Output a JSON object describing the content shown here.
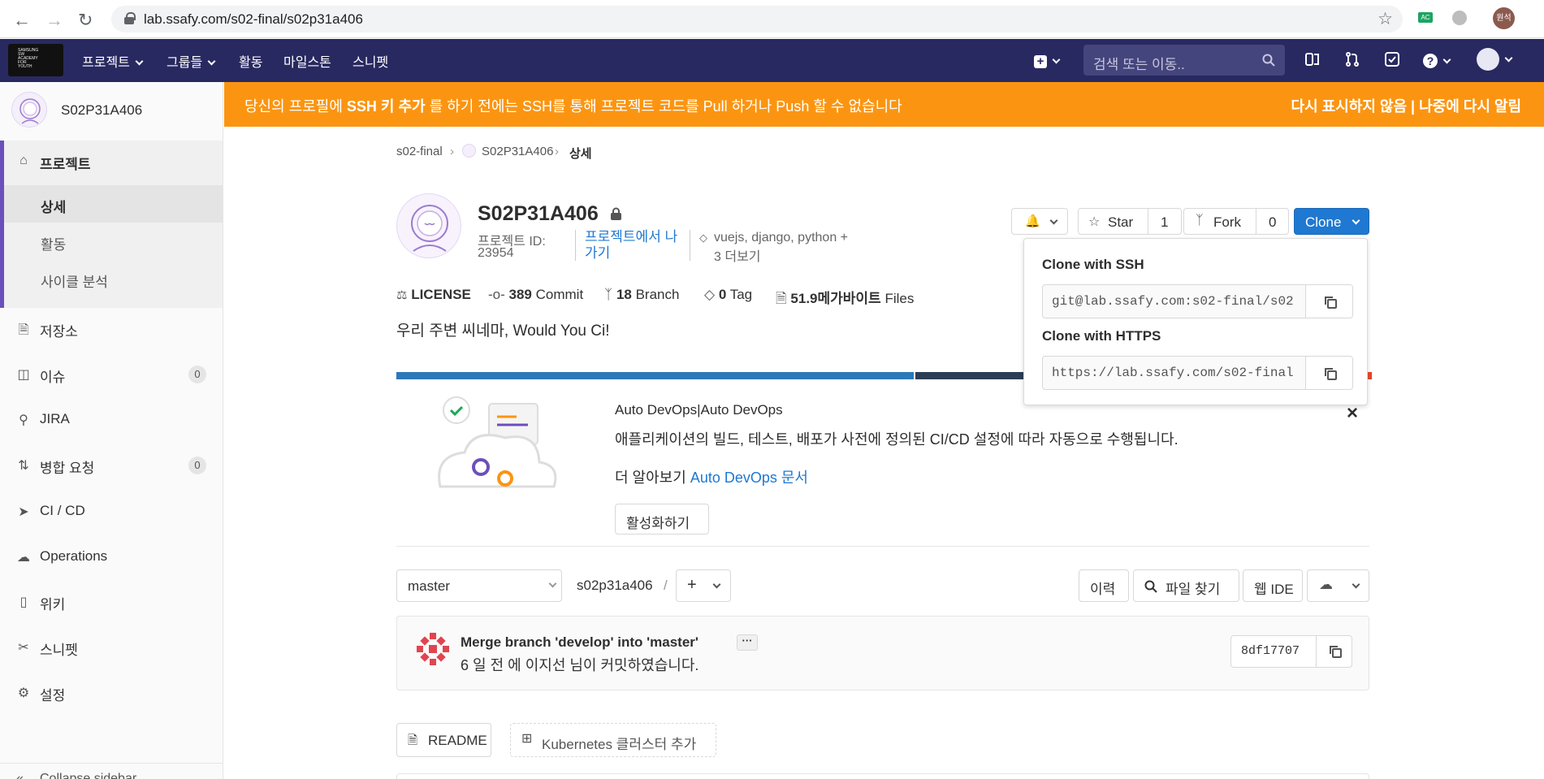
{
  "browser": {
    "url": "lab.ssafy.com/s02-final/s02p31a406",
    "profile_label": "원석",
    "ext_badge": "AC"
  },
  "topnav": {
    "items": [
      "프로젝트",
      "그룹들",
      "활동",
      "마일스톤",
      "스니펫"
    ],
    "search_placeholder": "검색 또는 이동.."
  },
  "sidebar": {
    "project_name": "S02P31A406",
    "section_title": "프로젝트",
    "sub_items": [
      "상세",
      "활동",
      "사이클 분석"
    ],
    "items": [
      {
        "label": "저장소"
      },
      {
        "label": "이슈",
        "badge": "0"
      },
      {
        "label": "JIRA"
      },
      {
        "label": "병합 요청",
        "badge": "0"
      },
      {
        "label": "CI / CD"
      },
      {
        "label": "Operations"
      },
      {
        "label": "위키"
      },
      {
        "label": "스니펫"
      },
      {
        "label": "설정"
      }
    ],
    "collapse_label": "Collapse sidebar"
  },
  "banner": {
    "pre": "당신의 프로필에 ",
    "bold": "SSH 키 추가",
    "post": " 를 하기 전에는 SSH를 통해 프로젝트 코드를 Pull 하거나 Push 할 수 없습니다",
    "dismiss": "다시 표시하지 않음",
    "sep": " | ",
    "later": "나중에 다시 알림"
  },
  "breadcrumb": [
    "s02-final",
    "S02P31A406",
    "상세"
  ],
  "project": {
    "title": "S02P31A406",
    "id_label": "프로젝트 ID:",
    "id_value": "23954",
    "leave_link": "프로젝트에서 나가기",
    "topics": "vuejs, django, python +",
    "more": "3 더보기",
    "star_label": "Star",
    "star_count": "1",
    "fork_label": "Fork",
    "fork_count": "0",
    "clone_label": "Clone",
    "description": "우리 주변 씨네마, Would You Ci!"
  },
  "stats": {
    "license": "LICENSE",
    "commit_count": "389",
    "commit_label": "Commit",
    "branch_count": "18",
    "branch_label": "Branch",
    "tag_count": "0",
    "tag_label": "Tag",
    "size": "51.9메가바이트",
    "size_label": "Files"
  },
  "clone_popup": {
    "ssh_title": "Clone with SSH",
    "ssh_url": "git@lab.ssafy.com:s02-final/s02",
    "https_title": "Clone with HTTPS",
    "https_url": "https://lab.ssafy.com/s02-final"
  },
  "devops": {
    "title": "Auto DevOps|Auto DevOps",
    "desc": "애플리케이션의 빌드, 테스트, 배포가 사전에 정의된 CI/CD 설정에 따라 자동으로 수행됩니다.",
    "learn_pre": "더 알아보기 ",
    "learn_link": "Auto DevOps 문서",
    "enable_button": "활성화하기",
    "close": "×"
  },
  "repo_toolbar": {
    "branch": "master",
    "path": "s02p31a406",
    "path_sep": "/",
    "history": "이력",
    "find_file": "파일 찾기",
    "web_ide": "웹 IDE"
  },
  "commit": {
    "title": "Merge branch 'develop' into 'master'",
    "meta": "6 일 전 에 이지선 님이 커밋하였습니다.",
    "sha": "8df17707"
  },
  "bottom_buttons": {
    "readme": "README",
    "kubernetes": "Kubernetes 클러스터 추가"
  },
  "colors": {
    "nav_bg": "#292961",
    "banner_bg": "#fb9511",
    "clone_button": "#1f78d1",
    "link": "#1f78d1",
    "progress_blue": "#2d78b8",
    "progress_dark": "#2b3d54"
  }
}
